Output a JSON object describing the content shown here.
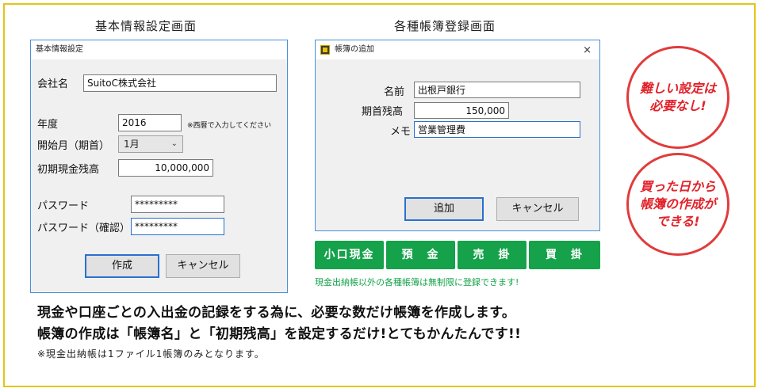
{
  "captions": {
    "left": "基本情報設定画面",
    "right": "各種帳簿登録画面"
  },
  "basic": {
    "title": "基本情報設定",
    "company_label": "会社名",
    "company_value": "SuitoC株式会社",
    "year_label": "年度",
    "year_value": "2016",
    "year_hint": "※西暦で入力してください",
    "start_month_label": "開始月（期首）",
    "start_month_value": "1月",
    "initial_cash_label": "初期現金残高",
    "initial_cash_value": "10,000,000",
    "password_label": "パスワード",
    "password_value": "*********",
    "password_confirm_label": "パスワード（確認）",
    "password_confirm_value": "*********",
    "create_button": "作成",
    "cancel_button": "キャンセル"
  },
  "ledger": {
    "title": "帳簿の追加",
    "close": "×",
    "name_label": "名前",
    "name_value": "出根戸銀行",
    "balance_label": "期首残高",
    "balance_value": "150,000",
    "memo_label": "メモ",
    "memo_value": "営業管理費",
    "add_button": "追加",
    "cancel_button": "キャンセル"
  },
  "ledger_types": [
    "小口現金",
    "預　金",
    "売　掛",
    "買　掛"
  ],
  "green_note": "現金出納帳以外の各種帳簿は無制限に登録できます!",
  "badges": {
    "top": [
      "難しい設定は",
      "必要なし!"
    ],
    "bottom": [
      "買った日から",
      "帳簿の作成が",
      "できる!"
    ]
  },
  "body": {
    "line1": "現金や口座ごとの入出金の記録をする為に、必要な数だけ帳簿を作成します。",
    "line2": "帳簿の作成は「帳簿名」と「初期残高」を設定するだけ!とてもかんたんです!!",
    "footnote": "※現金出納帳は1ファイル1帳簿のみとなります。"
  },
  "colors": {
    "border": "#e2c61a",
    "green": "#15a24a",
    "red": "#e2222a",
    "accent": "#2a6fd0"
  }
}
